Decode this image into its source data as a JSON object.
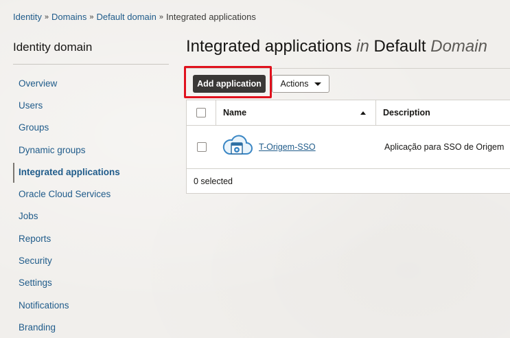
{
  "breadcrumb": {
    "items": [
      "Identity",
      "Domains",
      "Default domain"
    ],
    "separator": "»",
    "current": "Integrated applications"
  },
  "sidebar": {
    "title": "Identity domain",
    "items": [
      {
        "label": "Overview"
      },
      {
        "label": "Users"
      },
      {
        "label": "Groups"
      },
      {
        "label": "Dynamic groups"
      },
      {
        "label": "Integrated applications",
        "active": true
      },
      {
        "label": "Oracle Cloud Services"
      },
      {
        "label": "Jobs"
      },
      {
        "label": "Reports"
      },
      {
        "label": "Security"
      },
      {
        "label": "Settings"
      },
      {
        "label": "Notifications"
      },
      {
        "label": "Branding"
      }
    ]
  },
  "page": {
    "title_main": "Integrated applications",
    "title_in": "in",
    "title_domain": "Default",
    "title_domain_suffix": "Domain"
  },
  "toolbar": {
    "add_label": "Add application",
    "actions_label": "Actions",
    "highlight_color": "#e0111d"
  },
  "table": {
    "columns": [
      "Name",
      "Description"
    ],
    "sort": {
      "column": "Name",
      "direction": "ascending"
    },
    "rows": [
      {
        "name": "T-Origem-SSO",
        "description": "Aplicação para SSO de Origem",
        "icon": "cloud-app-icon"
      }
    ],
    "footer": "0 selected"
  },
  "colors": {
    "link": "#1f5b8a",
    "primary_button": "#3a3836"
  }
}
